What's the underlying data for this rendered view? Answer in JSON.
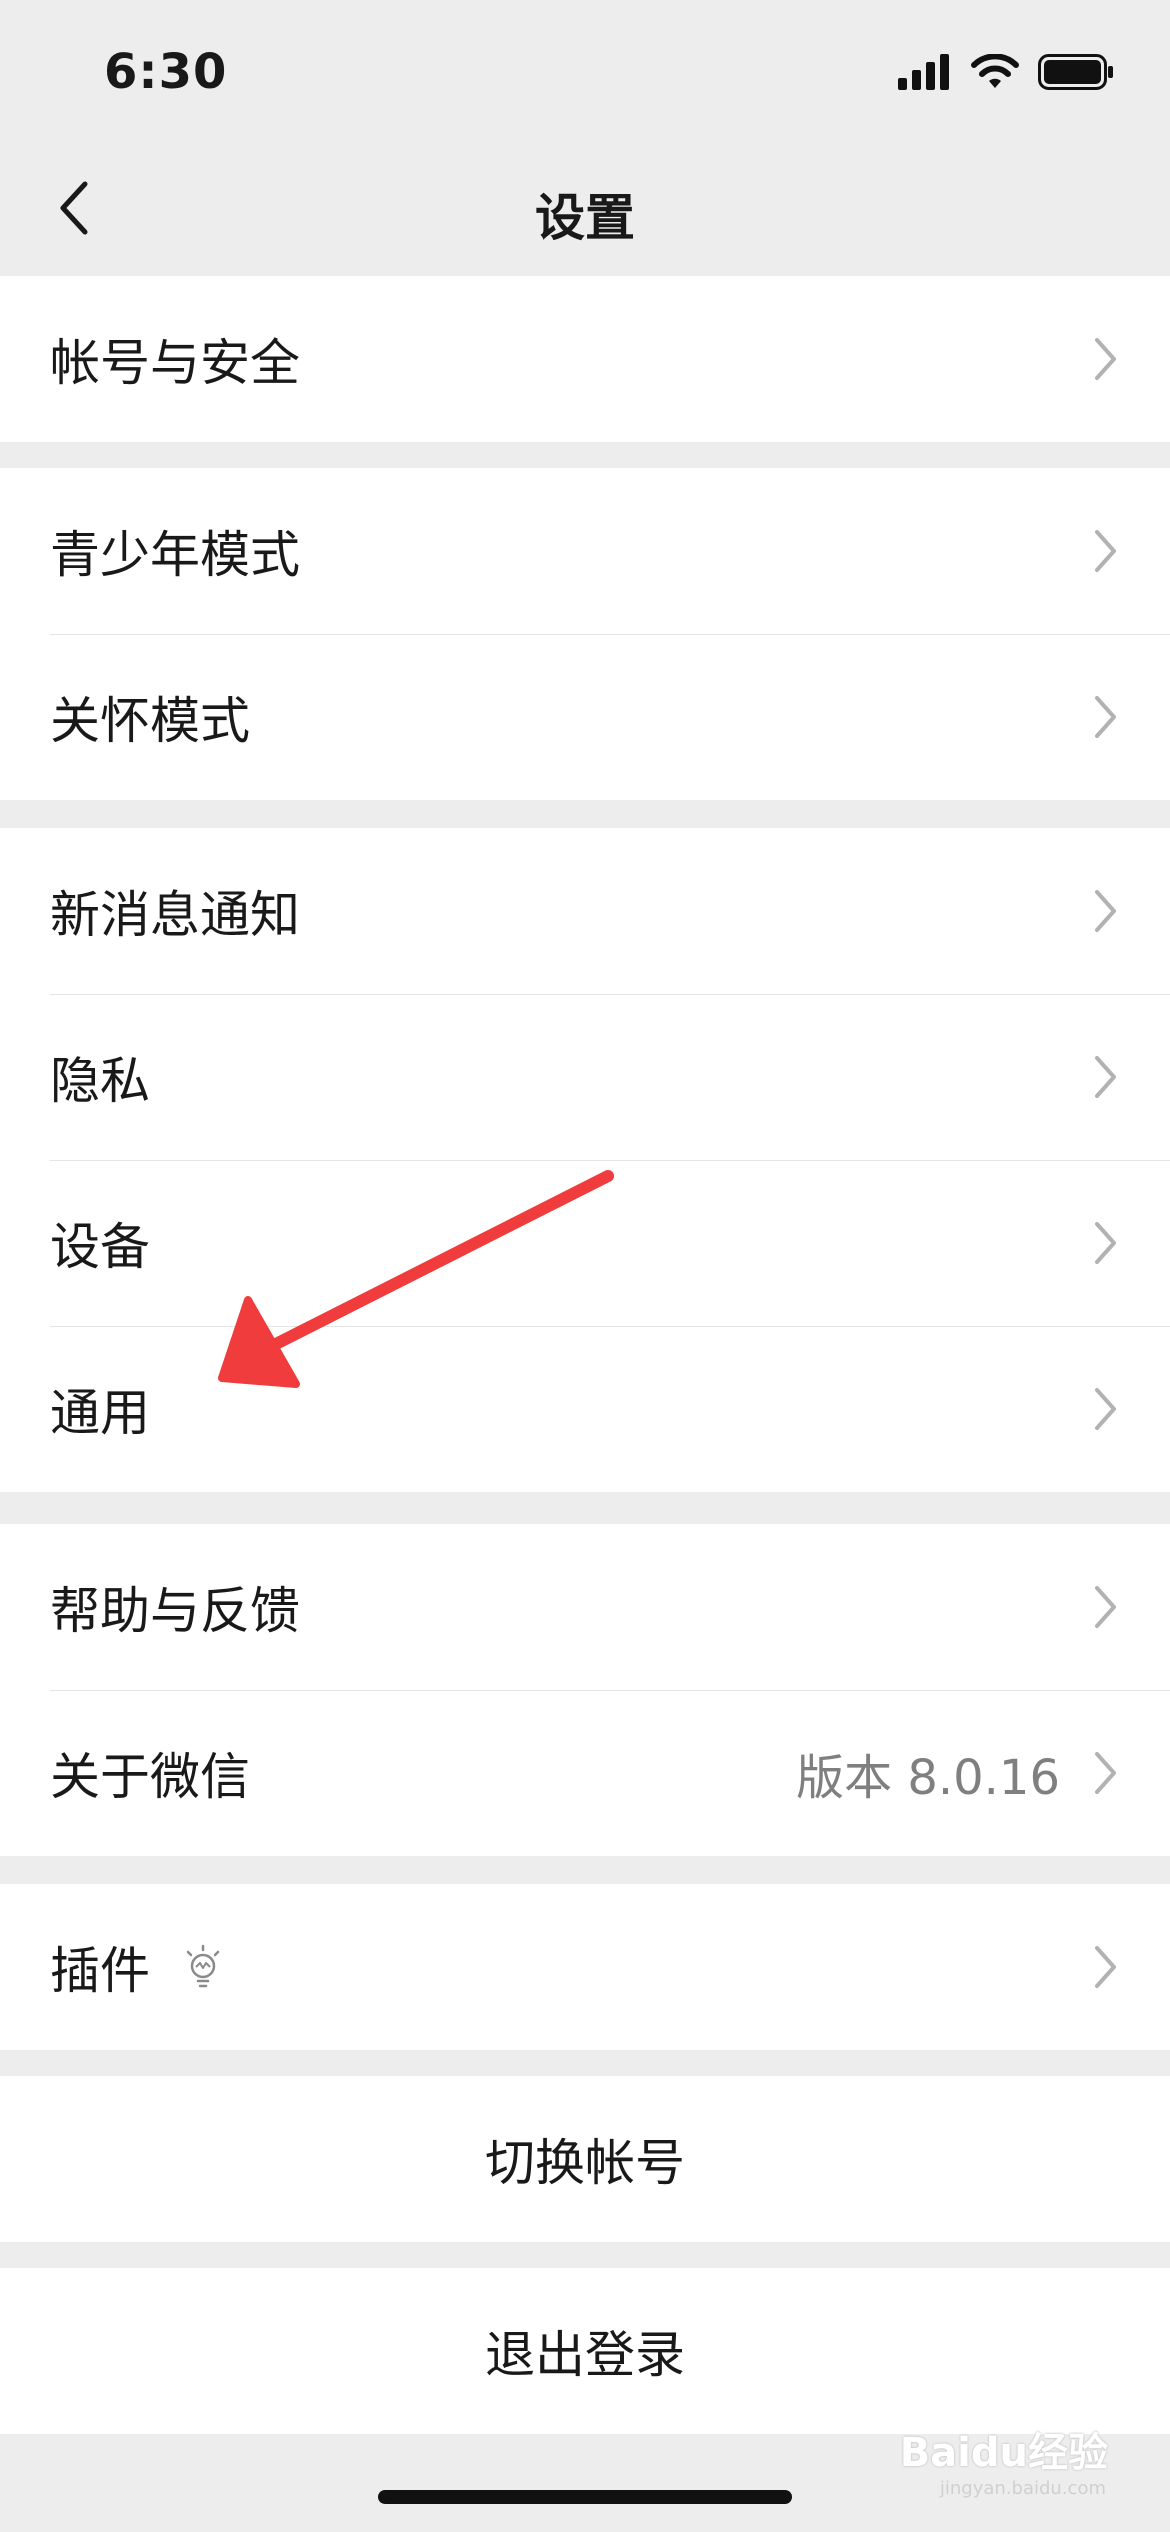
{
  "status_bar": {
    "time": "6:30",
    "icons": [
      "signal-icon",
      "wifi-icon",
      "battery-icon"
    ]
  },
  "nav": {
    "back_icon": "chevron-left-icon",
    "title": "设置"
  },
  "groups": [
    {
      "items": [
        {
          "label": "帐号与安全"
        }
      ]
    },
    {
      "items": [
        {
          "label": "青少年模式"
        },
        {
          "label": "关怀模式"
        }
      ]
    },
    {
      "items": [
        {
          "label": "新消息通知"
        },
        {
          "label": "隐私"
        },
        {
          "label": "设备"
        },
        {
          "label": "通用"
        }
      ]
    },
    {
      "items": [
        {
          "label": "帮助与反馈"
        },
        {
          "label": "关于微信",
          "value": "版本 8.0.16"
        }
      ]
    },
    {
      "items": [
        {
          "label": "插件",
          "icon": "lightbulb-icon"
        }
      ]
    }
  ],
  "actions": {
    "switch_account": "切换帐号",
    "logout": "退出登录"
  },
  "annotation": {
    "color": "#f03c3c",
    "points_to": "通用"
  },
  "watermark": {
    "brand": "Baidu经验",
    "site": "jingyan.baidu.com"
  }
}
